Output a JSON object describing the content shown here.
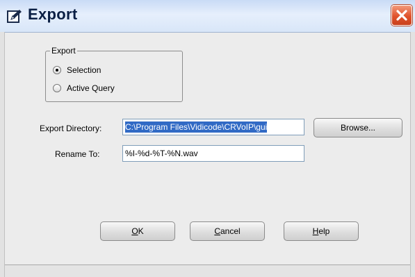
{
  "window": {
    "title": "Export",
    "title_icon": "pen-edit-icon",
    "close_icon": "close-icon"
  },
  "export_group": {
    "legend": "Export",
    "options": [
      {
        "label": "Selection",
        "checked": true
      },
      {
        "label": "Active Query",
        "checked": false
      }
    ]
  },
  "fields": {
    "export_directory": {
      "label": "Export Directory:",
      "value": "C:\\Program Files\\Vidicode\\CRVoIP\\gui"
    },
    "rename_to": {
      "label": "Rename To:",
      "value": "%I-%d-%T-%N.wav"
    }
  },
  "buttons": {
    "browse": "Browse...",
    "ok": {
      "mnemonic": "O",
      "rest": "K"
    },
    "cancel": {
      "mnemonic": "C",
      "rest": "ancel"
    },
    "help": {
      "mnemonic": "H",
      "rest": "elp"
    }
  },
  "colors": {
    "close_button": "#e0532c",
    "selection_highlight": "#316ac5",
    "title_bar": "#d8e6f8"
  }
}
